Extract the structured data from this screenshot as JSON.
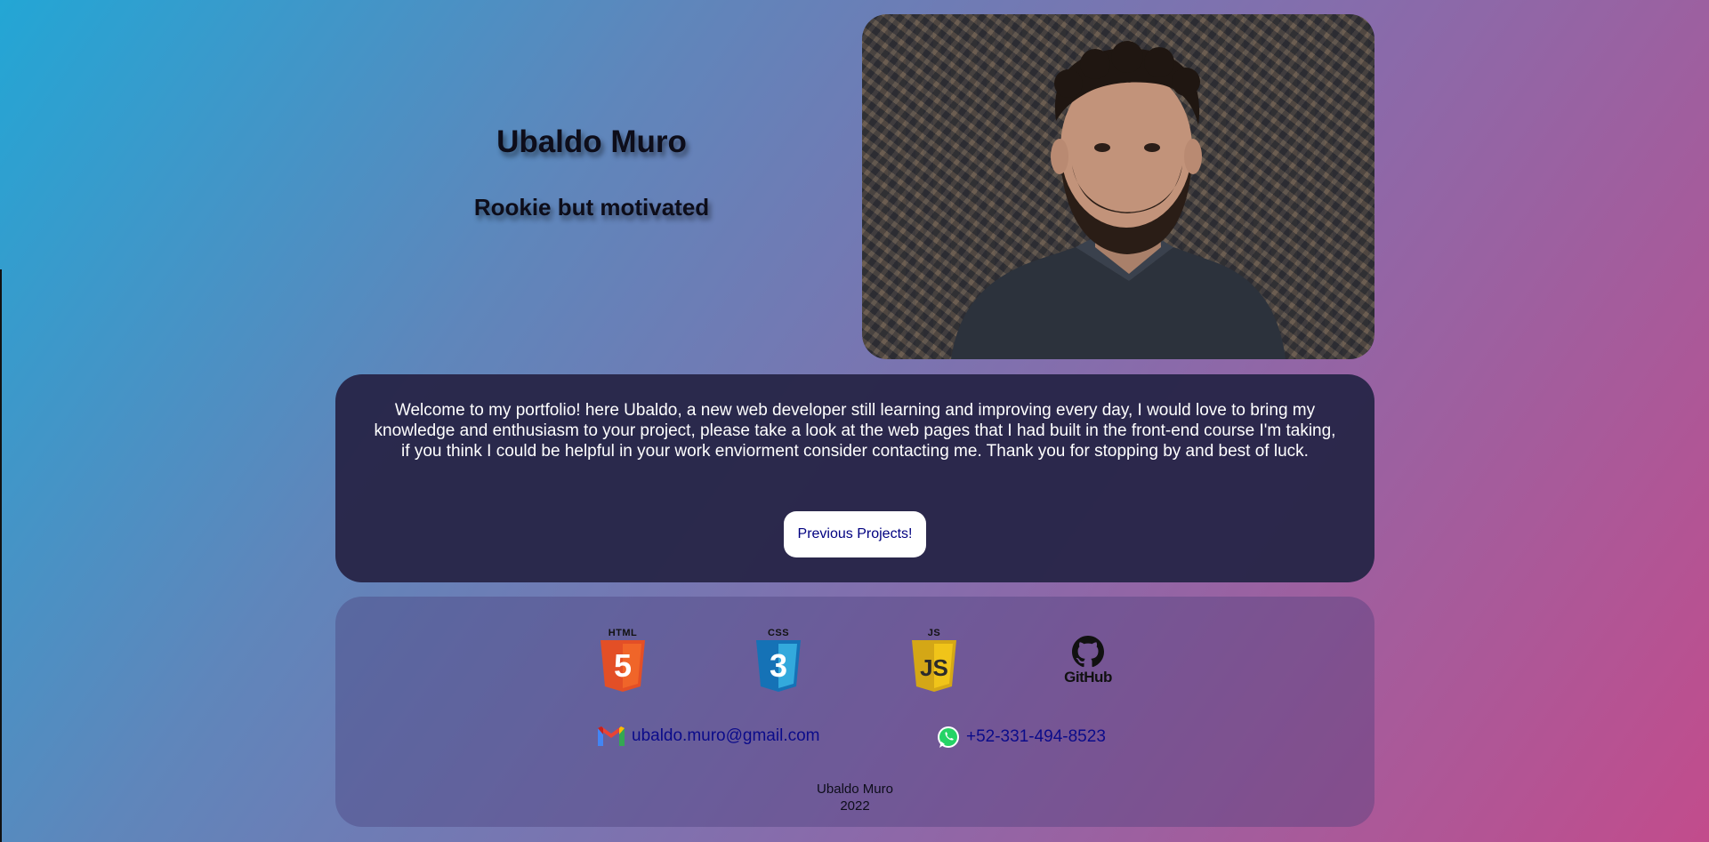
{
  "hero": {
    "name": "Ubaldo Muro",
    "tagline": "Rookie but motivated",
    "portrait_icon": "portrait-photo"
  },
  "welcome": {
    "text": "Welcome to my portfolio! here Ubaldo, a new web developer still learning and improving every day, I would love to bring my knowledge and enthusiasm to your project, please take a look at the web pages that I had built in the front-end course I'm taking, if you think I could be helpful in your work enviorment consider contacting me. Thank you for stopping by and best of luck.",
    "button_label": "Previous Projects!"
  },
  "tech": {
    "html_caption": "HTML",
    "html_glyph": "5",
    "css_caption": "CSS",
    "css_glyph": "3",
    "js_caption": "JS",
    "js_glyph": "JS",
    "github_word": "GitHub"
  },
  "contacts": {
    "email": "ubaldo.muro@gmail.com",
    "phone": "+52-331-494-8523"
  },
  "credit": {
    "name": "Ubaldo Muro",
    "year": "2022"
  },
  "colors": {
    "card_dark": "#282548",
    "button_text": "#000080",
    "link": "#0b0b8a",
    "html5": "#e34f26",
    "css3": "#1572b6",
    "js": "#f0c419"
  }
}
